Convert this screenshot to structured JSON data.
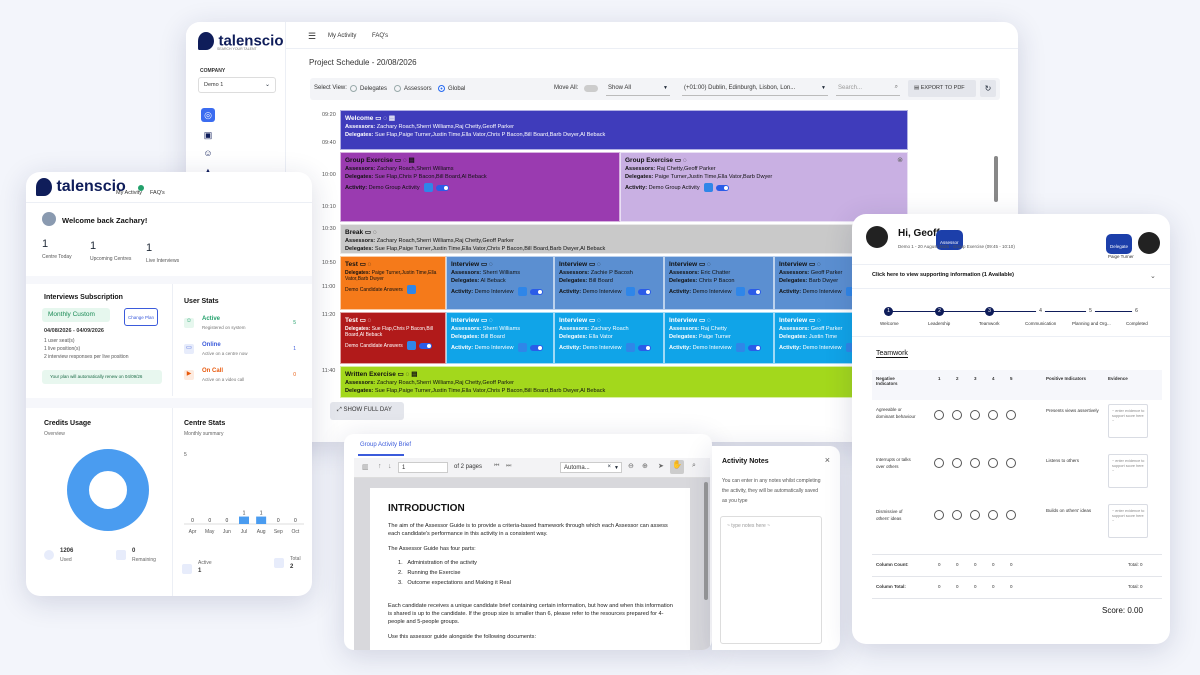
{
  "main": {
    "brand": "talenscio",
    "tagline": "SEARCH YOUR TALENT",
    "nav_tabs": [
      "My Activity",
      "FAQ's"
    ],
    "company_label": "COMPANY",
    "company_value": "Demo 1",
    "page_title": "Project Schedule - 20/08/2026",
    "select_view_label": "Select View:",
    "view_options": [
      "Delegates",
      "Assessors",
      "Global"
    ],
    "selected_view": "Global",
    "move_all_label": "Move All:",
    "show_select": "Show All",
    "timezone_select": "(+01:00) Dublin, Edinburgh, Lisbon, Lon...",
    "search_placeholder": "Search...",
    "export_label": "EXPORT TO PDF",
    "show_full_day": "SHOW FULL DAY",
    "times": [
      "09:20",
      "09:40",
      "10:00",
      "10:10",
      "10:30",
      "10:50",
      "11:00",
      "11:20",
      "11:40"
    ],
    "events": {
      "welcome": {
        "title": "Welcome",
        "assessors": "Zachary Roach,Sherri Williams,Raj Chetty,Geoff Parker",
        "delegates": "Sue Flap,Paige Turner,Justin Time,Ella Vator,Chris P Bacon,Bill Board,Barb Dwyer,Al Beback"
      },
      "group1": {
        "title": "Group Exercise",
        "assessors": "Zachary Roach,Sherri Williams",
        "delegates": "Sue Flap,Chris P Bacon,Bill Board,Al Beback",
        "activity": "Demo Group Activity"
      },
      "group2": {
        "title": "Group Exercise",
        "assessors": "Paige Turner,Justin Time,Ella Vator,Barb Dwyer",
        "delegates": "Raj Chetty,Geoff Parker",
        "activity": "Demo Group Activity"
      },
      "break": {
        "title": "Break",
        "assessors": "Zachary Roach,Sherri Williams,Raj Chetty,Geoff Parker",
        "delegates": "Sue Flap,Paige Turner,Justin Time,Ella Vator,Chris P Bacon,Bill Board,Barb Dwyer,Al Beback"
      },
      "test1": {
        "title": "Test",
        "delegates": "Paige Turner,Justin Time,Ella Vator,Barb Dwyer",
        "activity": "Demo Candidate Answers"
      },
      "test2": {
        "title": "Test",
        "delegates": "Sue Flap,Chris P Bacon,Bill Board,Al Beback",
        "activity": "Demo Candidate Answers"
      },
      "interviews_row1": [
        {
          "title": "Interview",
          "assessors": "Sherri Williams",
          "delegates": "Al Beback",
          "activity": "Demo Interview"
        },
        {
          "title": "Interview",
          "assessors": "Zachie P Bacosh",
          "delegates": "Bill Board",
          "activity": "Demo Interview"
        },
        {
          "title": "Interview",
          "assessors": "Eric Chatter",
          "delegates": "Chris P Bacon",
          "activity": "Demo Interview"
        },
        {
          "title": "Interview",
          "assessors": "Geoff Parker",
          "delegates": "Barb Dwyer",
          "activity": "Demo Interview"
        }
      ],
      "interviews_row2": [
        {
          "title": "Interview",
          "assessors": "Sherri Williams",
          "delegates": "Bill Board",
          "activity": "Demo Interview"
        },
        {
          "title": "Interview",
          "assessors": "Zachary Roach",
          "delegates": "Ella Vator",
          "activity": "Demo Interview"
        },
        {
          "title": "Interview",
          "assessors": "Raj Chetty",
          "delegates": "Paige Turner",
          "activity": "Demo Interview"
        },
        {
          "title": "Interview",
          "assessors": "Geoff Parker",
          "delegates": "Justin Time",
          "activity": "Demo Interview"
        }
      ],
      "written": {
        "title": "Written Exercise",
        "assessors": "Zachary Roach,Sherri Williams,Raj Chetty,Geoff Parker",
        "delegates": "Sue Flap,Paige Turner,Justin Time,Ella Vator,Chris P Bacon,Bill Board,Barb Dwyer,Al Beback"
      }
    },
    "labels": {
      "assessors": "Assessors:",
      "delegates": "Delegates:",
      "activity": "Activity:"
    }
  },
  "dash": {
    "brand": "talenscio",
    "nav": [
      "My Activity",
      "FAQ's"
    ],
    "welcome": "Welcome back Zachary!",
    "stats": [
      {
        "value": "1",
        "label": "Centre Today"
      },
      {
        "value": "1",
        "label": "Upcoming Centres"
      },
      {
        "value": "1",
        "label": "Live Interviews"
      }
    ],
    "subscription": {
      "title": "Interviews Subscription",
      "plan": "Monthly Custom",
      "change_plan": "Change Plan",
      "dates": "04/08/2026 - 04/09/2026",
      "line1": "1 user seat(s)",
      "line2": "1 live position(s)",
      "line3": "2 interview responses per live position",
      "renew": "Your plan will automatically renew on 04/09/26"
    },
    "user_stats": {
      "title": "User Stats",
      "items": [
        {
          "label": "Active",
          "sub": "Registered on system",
          "count": "5",
          "color": "#22a06b"
        },
        {
          "label": "Online",
          "sub": "Active on a centre now",
          "count": "1",
          "color": "#3b5bdb"
        },
        {
          "label": "On Call",
          "sub": "Active on a video call",
          "count": "0",
          "color": "#e8590c"
        }
      ]
    },
    "credits": {
      "title": "Credits Usage",
      "sub": "Overview",
      "used": "1206",
      "used_label": "Used",
      "remaining": "0",
      "remaining_label": "Remaining"
    },
    "centre_stats": {
      "title": "Centre Stats",
      "sub": "Monthly summary",
      "y_max": "5",
      "active_label": "Active",
      "active": "1",
      "total_label": "Total",
      "total": "2"
    }
  },
  "chart_data": {
    "type": "bar",
    "categories": [
      "Apr",
      "May",
      "Jun",
      "Jul",
      "Aug",
      "Sep",
      "Oct"
    ],
    "values": [
      0,
      0,
      0,
      1,
      1,
      0,
      0
    ],
    "ylim": [
      0,
      5
    ]
  },
  "brief": {
    "tab": "Group Activity Brief",
    "page_input": "1",
    "page_total": "of 2 pages",
    "zoom": "Automa...",
    "heading": "INTRODUCTION",
    "p1": "The aim of the Assessor Guide is to provide a criteria-based framework through which each Assessor can assess each candidate's performance in this activity in a consistent way.",
    "p2": "The Assessor Guide has four parts:",
    "list": [
      "Administration of the activity",
      "Running the Exercise",
      "Outcome expectations and Making it Real"
    ],
    "p3": "Each candidate receives a unique candidate brief containing certain information, but how and when this information is shared is up to the candidate. If the group size is smaller than 6, please refer to the resources prepared for 4-people and 5-people groups.",
    "p4": "Use this assessor guide alongside the following documents:"
  },
  "notes": {
    "title": "Activity Notes",
    "body": "You can enter in any notes whilst completing the activity, they will be automatically saved as you type",
    "placeholder": "~ type notes here ~"
  },
  "eval": {
    "greeting": "Hi, Geoff",
    "role_badge": "Assessor",
    "subtitle": "Demo 1 - 20 August 2026 - Group Exercise (09:45 - 10:10)",
    "delegate_badge": "Delegate",
    "delegate_name": "Paige Turner",
    "info_link": "Click here to view supporting information (1 Available)",
    "steps": [
      {
        "n": "1",
        "label": "Welcome",
        "done": true
      },
      {
        "n": "2",
        "label": "Leadership",
        "done": true
      },
      {
        "n": "3",
        "label": "Teamwork",
        "done": true
      },
      {
        "n": "4",
        "label": "Communication",
        "done": false
      },
      {
        "n": "5",
        "label": "Planning and Org...",
        "done": false
      },
      {
        "n": "6",
        "label": "Completed",
        "done": false
      }
    ],
    "section": "Teamwork",
    "headers": {
      "neg": "Negative Indicators",
      "pos": "Positive Indicators",
      "evidence": "Evidence",
      "scores": [
        "1",
        "2",
        "3",
        "4",
        "5"
      ]
    },
    "rows": [
      {
        "neg": "Agreeable or dominant behaviour",
        "pos": "Presents views assertively",
        "ev": "~ enter evidence to support score here ~"
      },
      {
        "neg": "Interrupts or talks over others",
        "pos": "Listens to others",
        "ev": "~ enter evidence to support score here ~"
      },
      {
        "neg": "Dismissive of others' ideas",
        "pos": "Builds on others' ideas",
        "ev": "~ enter evidence to support score here ~"
      }
    ],
    "column_count_label": "Column Count:",
    "column_total_label": "Column Total:",
    "zeros": [
      "0",
      "0",
      "0",
      "0",
      "0"
    ],
    "total_label": "Total:",
    "total_value": "0",
    "score": "Score: 0.00"
  }
}
